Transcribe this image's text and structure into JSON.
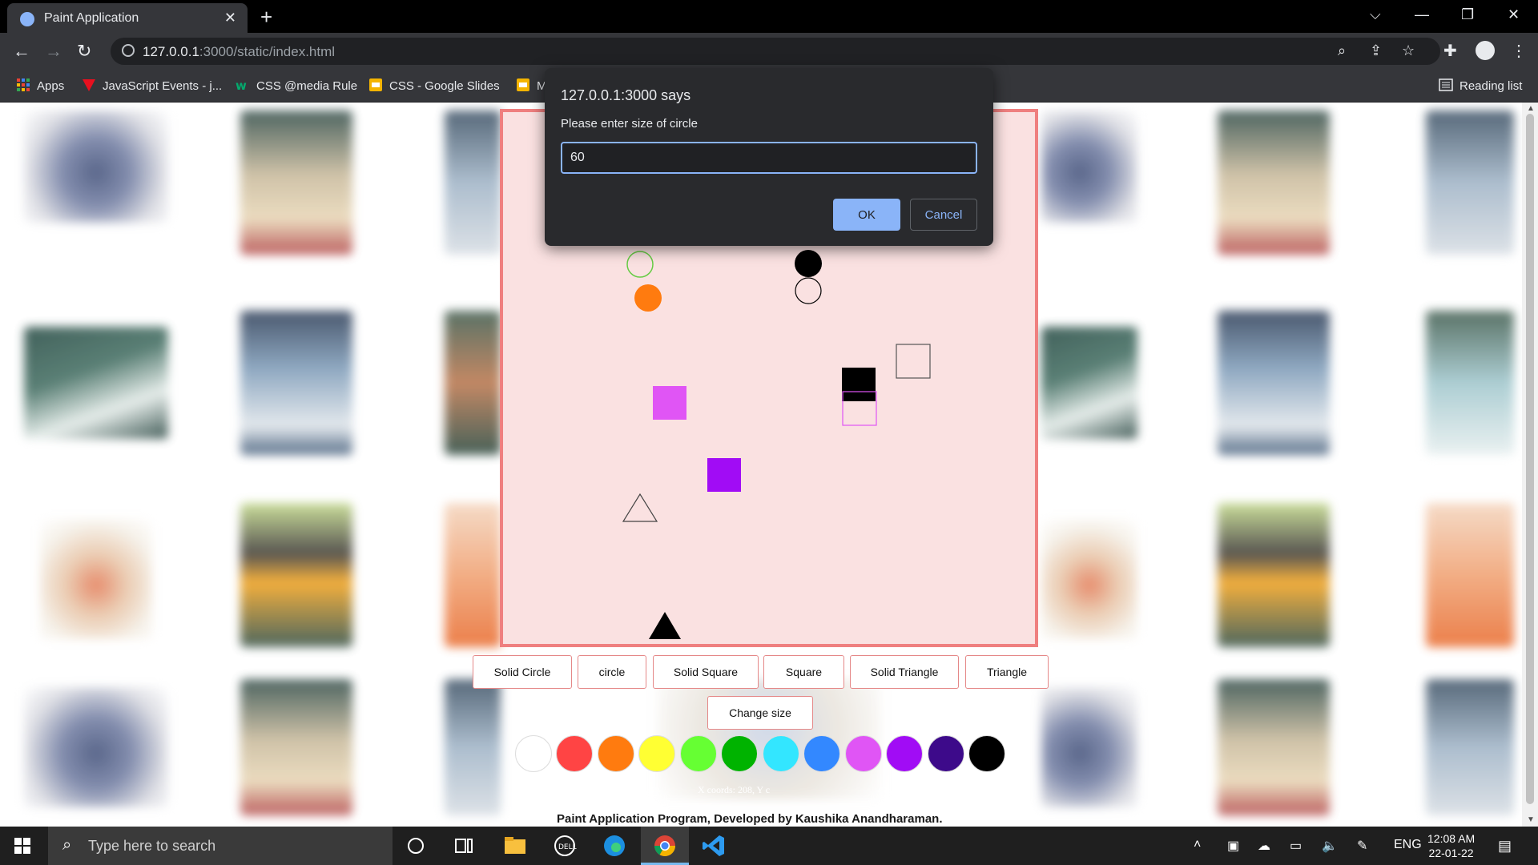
{
  "browser": {
    "tab_title": "Paint Application",
    "tab_close": "✕",
    "new_tab": "+",
    "window_controls": {
      "tab_search": "⌵",
      "minimize": "—",
      "restore": "❐",
      "close": "✕"
    },
    "url_host": "127.0.0.1",
    "url_rest": ":3000/static/index.html",
    "bookmarks": [
      {
        "label": "Apps",
        "icon": "apps-grid-icon",
        "color": "#ea4335"
      },
      {
        "label": "JavaScript Events - j...",
        "icon": "bookmark-favicon-icon",
        "color": "#e8101f"
      },
      {
        "label": "CSS @media Rule",
        "icon": "w3schools-icon",
        "color": "#04aa6d"
      },
      {
        "label": "CSS - Google Slides",
        "icon": "slides-icon",
        "color": "#f4b400"
      },
      {
        "label": "M",
        "icon": "slides-icon",
        "color": "#f4b400"
      }
    ],
    "reading_list": "Reading list"
  },
  "dialog": {
    "title": "127.0.0.1:3000 says",
    "message": "Please enter size of circle",
    "input_value": "60",
    "ok_label": "OK",
    "cancel_label": "Cancel"
  },
  "app": {
    "shape_buttons": [
      "Solid Circle",
      "circle",
      "Solid Square",
      "Square",
      "Solid Triangle",
      "Triangle"
    ],
    "change_size_label": "Change size",
    "colors": [
      "#ffffff",
      "#ff4444",
      "#ff7b0f",
      "#ffff33",
      "#66ff33",
      "#00b300",
      "#33e6ff",
      "#3388ff",
      "#e055f5",
      "#a10cf5",
      "#3d0a8a",
      "#000000"
    ],
    "coords_text": "X coords: 208, Y c",
    "footer": "Paint Application Program, Developed by Kaushika Anandharaman.",
    "canvas_border_color": "#ef7f7f",
    "canvas_bg_color": "#fae1e1"
  },
  "taskbar": {
    "search_placeholder": "Type here to search",
    "language": "ENG",
    "time": "12:08 AM",
    "date": "22-01-22"
  }
}
